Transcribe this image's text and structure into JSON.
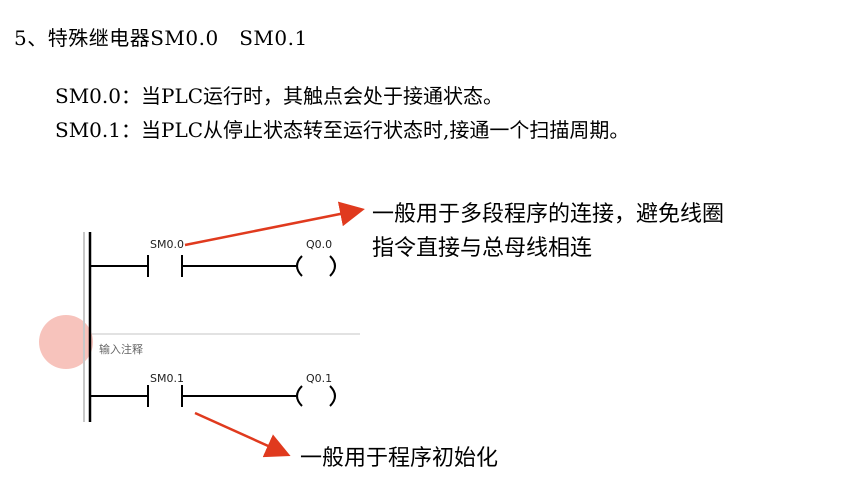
{
  "title": "5、特殊继电器SM0.0　SM0.1",
  "descriptions": [
    "SM0.0：当PLC运行时，其触点会处于接通状态。",
    "SM0.1：当PLC从停止状态转至运行状态时,接通一个扫描周期。"
  ],
  "ladder": {
    "rung1": {
      "contact": "SM0.0",
      "coil": "Q0.0"
    },
    "comment_placeholder": "输入注释",
    "rung2": {
      "contact": "SM0.1",
      "coil": "Q0.1"
    }
  },
  "annotations": {
    "note1_line1": "一般用于多段程序的连接，避免线圈",
    "note1_line2": "指令直接与总母线相连",
    "note2": "一般用于程序初始化"
  },
  "colors": {
    "arrow": "#e03a1e",
    "highlight": "#f6b9b0",
    "wire": "#000000"
  }
}
